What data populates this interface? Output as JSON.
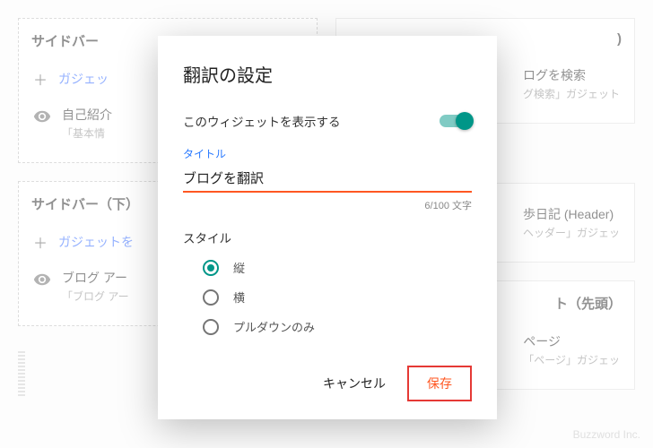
{
  "bg": {
    "left": {
      "sidebar_top": {
        "title": "サイドバー",
        "add_gadget": "ガジェッ",
        "item1": {
          "title": "自己紹介",
          "sub": "「基本情"
        }
      },
      "sidebar_bottom": {
        "title": "サイドバー（下）",
        "add_gadget": "ガジェットを",
        "item1": {
          "title": "ブログ アー",
          "sub": "「ブログ アー"
        }
      }
    },
    "right": {
      "header_suffix": ")",
      "search": {
        "title": "ログを検索",
        "sub": "グ検索」ガジェット"
      },
      "header2": {
        "title": "歩日記 (Header)",
        "sub": "ヘッダー」ガジェッ"
      },
      "section3": {
        "title": "ト（先頭）",
        "item_title": "ページ",
        "item_sub": "「ページ」ガジェッ"
      }
    }
  },
  "modal": {
    "title": "翻訳の設定",
    "show_widget": "このウィジェットを表示する",
    "title_field_label": "タイトル",
    "title_value": "ブログを翻訳",
    "char_count": "6/100 文字",
    "style_label": "スタイル",
    "options": {
      "vertical": "縦",
      "horizontal": "横",
      "pulldown": "プルダウンのみ"
    },
    "cancel": "キャンセル",
    "save": "保存"
  },
  "footer": "Buzzword Inc."
}
